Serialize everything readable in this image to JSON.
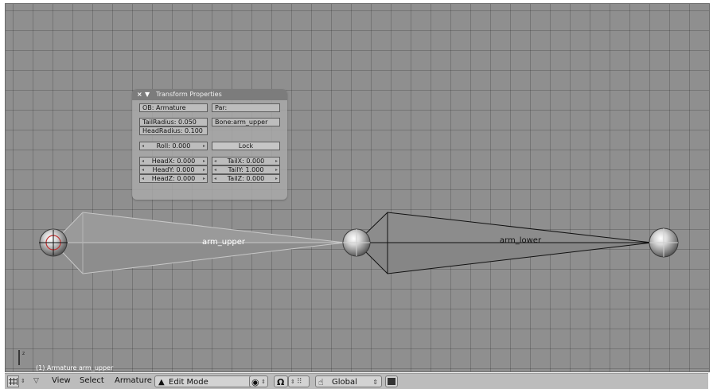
{
  "panel": {
    "title": "Transform Properties",
    "close_icon": "×",
    "collapse_icon": "▼",
    "object": "OB: Armature",
    "parent": "Par:",
    "tail_radius": "TailRadius: 0.050",
    "head_radius": "HeadRadius: 0.100",
    "bone": "Bone:arm_upper",
    "roll": "Roll: 0.000",
    "lock": "Lock",
    "head_x": "HeadX: 0.000",
    "head_y": "HeadY: 0.000",
    "head_z": "HeadZ: 0.000",
    "tail_x": "TailX: 0.000",
    "tail_y": "TailY: 1.000",
    "tail_z": "TailZ: 0.000"
  },
  "bones": {
    "upper_label": "arm_upper",
    "lower_label": "arm_lower"
  },
  "viewport": {
    "object_label": "(1) Armature arm_upper",
    "axis_label": "z"
  },
  "header": {
    "view": "View",
    "select": "Select",
    "armature": "Armature",
    "mode": "Edit Mode",
    "transform_orientation": "Global"
  },
  "icons": [
    "grid-icon",
    "menu-collapse-icon",
    "edit-mode-icon",
    "pivot-icon",
    "magnet-icon",
    "snap-icon",
    "hand-icon",
    "render-icon"
  ],
  "colors": {
    "viewport_bg": "#8f8f8f",
    "bone_fill": "#8a8a8a",
    "selected_bone_fill": "#9a9a9a",
    "header_bg": "#bcbcbc"
  }
}
